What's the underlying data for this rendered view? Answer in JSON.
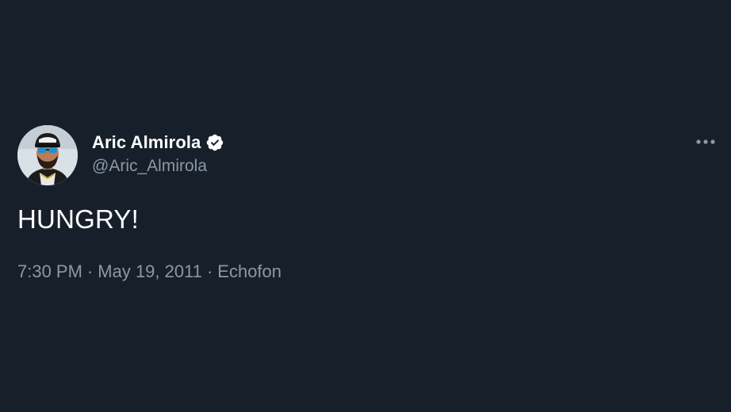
{
  "author": {
    "display_name": "Aric Almirola",
    "handle": "@Aric_Almirola",
    "verified": true,
    "avatar_icon": "profile-photo"
  },
  "tweet": {
    "text": "HUNGRY!"
  },
  "meta": {
    "time": "7:30 PM",
    "separator": "·",
    "date": "May 19, 2011",
    "source": "Echofon"
  },
  "menu": {
    "icon": "more-options-icon"
  },
  "colors": {
    "background": "#17202a",
    "primary_text": "#ffffff",
    "secondary_text": "#8b98a5",
    "verified_badge": "#ffffff"
  }
}
